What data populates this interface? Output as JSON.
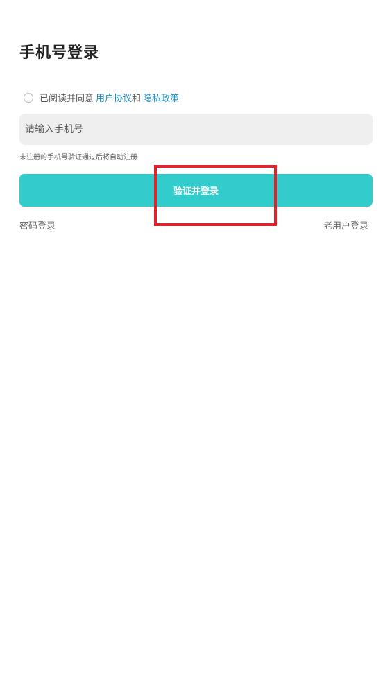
{
  "page": {
    "title": "手机号登录"
  },
  "agreement": {
    "prefix": "已阅读并同意",
    "user_agreement": "用户协议",
    "and": "和",
    "privacy_policy": "隐私政策"
  },
  "phone": {
    "placeholder": "请输入手机号",
    "value": ""
  },
  "hint": "未注册的手机号验证通过后将自动注册",
  "buttons": {
    "verify_login": "验证并登录",
    "password_login": "密码登录",
    "old_user_login": "老用户登录"
  },
  "colors": {
    "accent": "#33cccc",
    "link": "#1f8fc4",
    "highlight": "#e0232c",
    "input_bg": "#efefef"
  }
}
